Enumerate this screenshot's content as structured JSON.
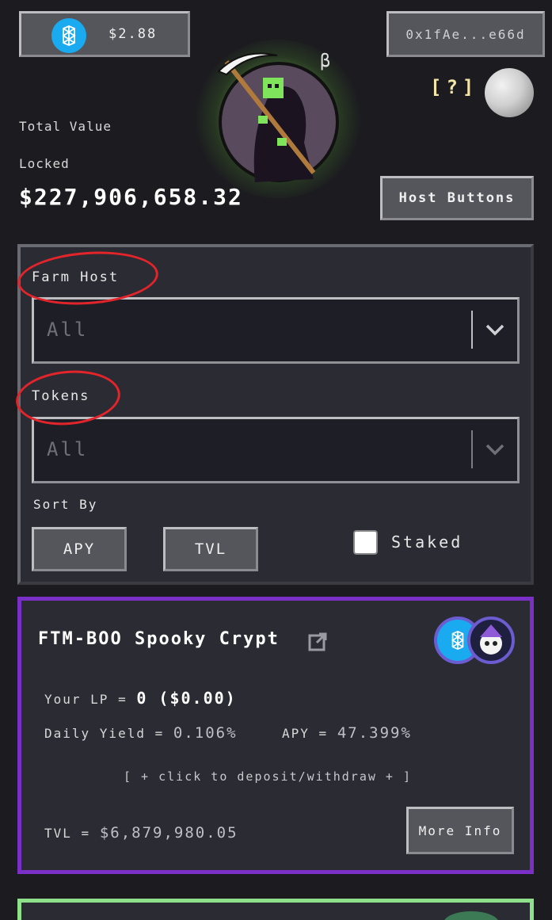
{
  "header": {
    "price": "$2.88",
    "wallet": "0x1fAe...e66d",
    "help": "[?]",
    "tvl_label_line1": "Total Value",
    "tvl_label_line2": "Locked",
    "tvl_value": "$227,906,658.32",
    "host_buttons": "Host Buttons"
  },
  "filters": {
    "farm_host_label": "Farm Host",
    "farm_host_value": "All",
    "tokens_label": "Tokens",
    "tokens_value": "All",
    "sort_by_label": "Sort By",
    "sort_options": [
      "APY",
      "TVL"
    ],
    "staked_label": "Staked"
  },
  "vault": {
    "name": "FTM-BOO Spooky Crypt",
    "your_lp_label": "Your LP =",
    "your_lp_value": "0 ($0.00)",
    "daily_yield_label": "Daily Yield =",
    "daily_yield_value": "0.106%",
    "apy_label": "APY =",
    "apy_value": "47.399%",
    "deposit_link": "[ + click to deposit/withdraw + ]",
    "tvl_label": "TVL =",
    "tvl_value": "$6,879,980.05",
    "more_info": "More Info",
    "border_color": "#7a2fc7"
  },
  "colors": {
    "annotation": "#e3242b",
    "next_card_border": "#8ee08a",
    "ftm_blue": "#1aaaf0"
  }
}
